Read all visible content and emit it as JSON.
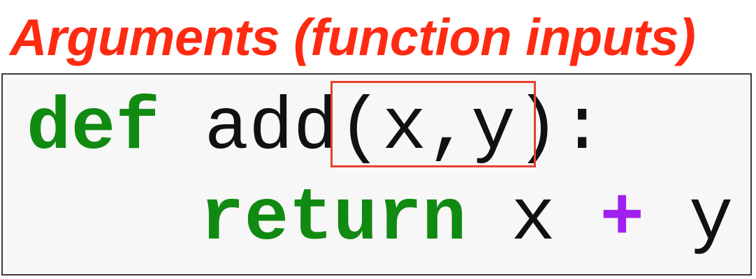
{
  "title": {
    "text": "Arguments (function inputs)",
    "color": "#ff2a12"
  },
  "code": {
    "line1": {
      "keyword": "def",
      "name": "add",
      "params": "(x,y)",
      "colon": ":"
    },
    "line2": {
      "keyword": "return",
      "left": "x",
      "operator": "+",
      "right": "y"
    }
  },
  "colors": {
    "keyword": "#118a11",
    "operator": "#a020f0",
    "text": "#111111",
    "highlight_border": "#e8412e",
    "code_background": "#f7f7f7"
  }
}
